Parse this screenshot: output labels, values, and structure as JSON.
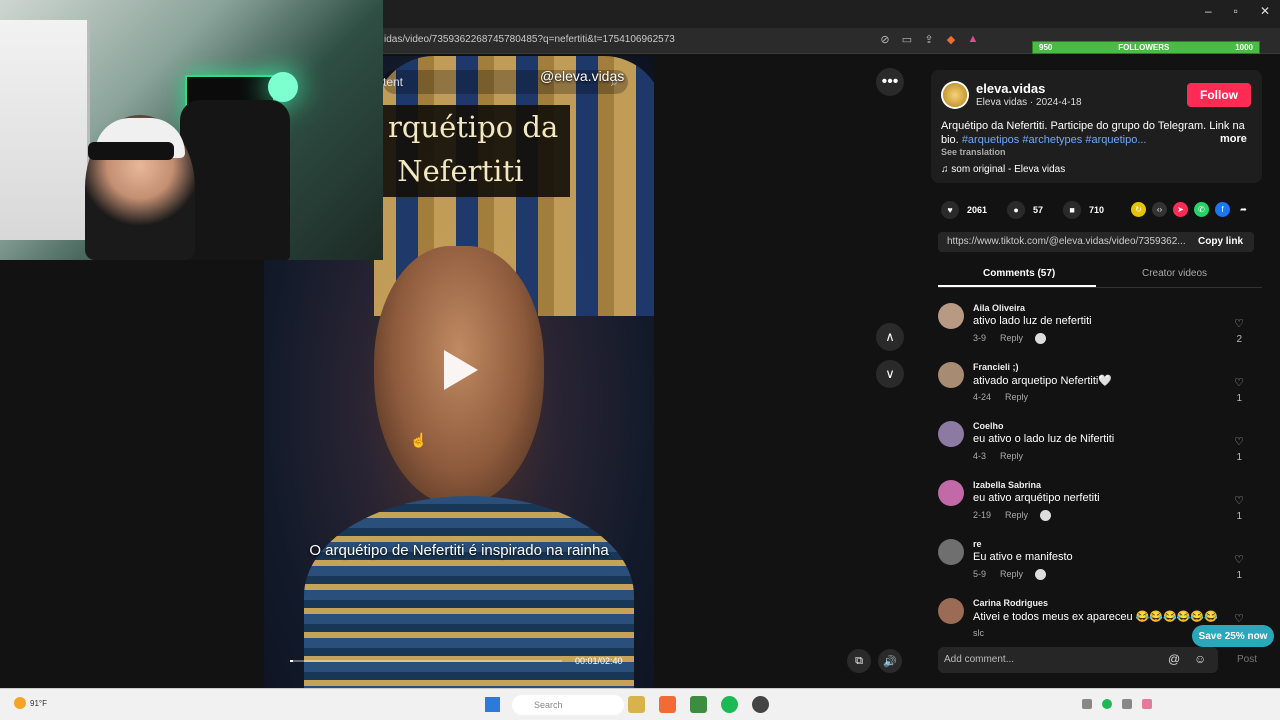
{
  "browser": {
    "url": "idas/video/7359362268745780485?q=nefertiti&t=1754106962573"
  },
  "followers_goal": {
    "current": "950",
    "label": "FOLLOWERS",
    "target": "1000"
  },
  "video": {
    "handle": "@eleva.vidas",
    "search_partial": "tent",
    "title_lines": "rquétipo da\n Nefertiti",
    "caption": "O arquétipo de Nefertiti é inspirado na rainha",
    "timecode": "00:01/02:40",
    "progress": 0.0104
  },
  "post": {
    "username": "eleva.vidas",
    "display_name": "Eleva vidas · 2024-4-18",
    "follow_label": "Follow",
    "description": "Arquétipo da Nefertiti. Participe do grupo do Telegram. Link na bio.",
    "tags": "#arquetipos #archetypes #arquetipo...",
    "more_label": "more",
    "see_translation": "See translation",
    "music": "♫  som original - Eleva vidas",
    "likes": "2061",
    "comments": "57",
    "saves": "710",
    "link": "https://www.tiktok.com/@eleva.vidas/video/7359362...",
    "copy_link": "Copy link"
  },
  "tabs": {
    "comments": "Comments (57)",
    "creator": "Creator videos"
  },
  "comments": [
    {
      "user": "Aila Oliveira",
      "text": "ativo lado luz de nefertiti",
      "date": "3-9",
      "reply": "Reply",
      "likes": "2",
      "color": "#b89a84",
      "creator_liked": true
    },
    {
      "user": "Francieli ;)",
      "text": "ativado arquetipo Nefertiti🤍",
      "date": "4-24",
      "reply": "Reply",
      "likes": "1",
      "color": "#a88b73",
      "creator_liked": false
    },
    {
      "user": "Coelho",
      "text": "eu ativo o lado luz de Nifertiti",
      "date": "4-3",
      "reply": "Reply",
      "likes": "1",
      "color": "#8c7aa3",
      "creator_liked": false
    },
    {
      "user": "Izabella Sabrina",
      "text": "eu ativo arquétipo nerfetiti",
      "date": "2-19",
      "reply": "Reply",
      "likes": "1",
      "color": "#c26aa8",
      "creator_liked": true
    },
    {
      "user": "re",
      "text": "Eu ativo e manifesto",
      "date": "5-9",
      "reply": "Reply",
      "likes": "1",
      "color": "#6f6f6f",
      "creator_liked": true
    },
    {
      "user": "Carina Rodrigues",
      "text": "Ativei e todos meus ex apareceu 😂😂😂😂😂😂",
      "date": "slc",
      "reply": "",
      "likes": "",
      "color": "#9a6b55",
      "creator_liked": false
    }
  ],
  "save_pill": "Save 25% now",
  "add_comment": {
    "placeholder": "Add comment...",
    "post": "Post"
  },
  "taskbar": {
    "weather": "91°F",
    "search": "Search"
  }
}
